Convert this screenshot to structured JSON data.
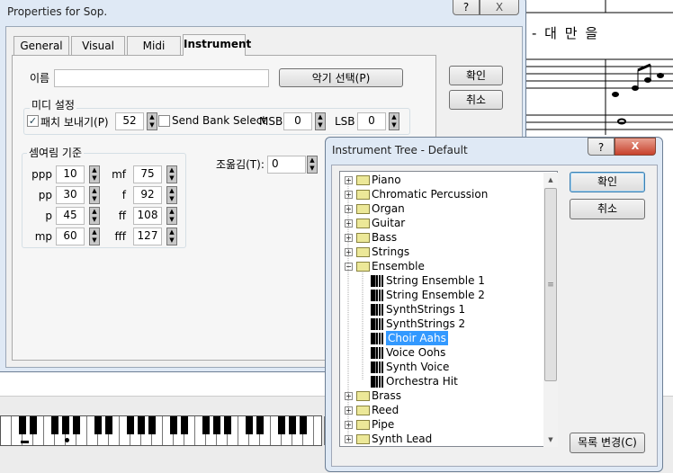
{
  "score": {
    "lyrics": "- 대 만   을"
  },
  "properties": {
    "title": "Properties for Sop.",
    "tabs": [
      {
        "label": "General"
      },
      {
        "label": "Visual"
      },
      {
        "label": "Midi"
      },
      {
        "label": "Instrument",
        "active": true
      }
    ],
    "ok": "확인",
    "cancel": "취소",
    "name_label": "이름",
    "name_value": "",
    "select_instrument": "악기 선택(P)",
    "midi_group": "미디 설정",
    "send_patch_label": "패치 보내기(P)",
    "send_patch_checked": true,
    "patch_value": "52",
    "send_bank_label": "Send Bank Select",
    "send_bank_checked": false,
    "msb_label": "MSB",
    "msb_value": "0",
    "lsb_label": "LSB",
    "lsb_value": "0",
    "dynamics_group": "셈여림 기준",
    "dynamics_left": [
      {
        "label": "ppp",
        "value": "10"
      },
      {
        "label": "pp",
        "value": "30"
      },
      {
        "label": "p",
        "value": "45"
      },
      {
        "label": "mp",
        "value": "60"
      }
    ],
    "dynamics_right": [
      {
        "label": "mf",
        "value": "75"
      },
      {
        "label": "f",
        "value": "92"
      },
      {
        "label": "ff",
        "value": "108"
      },
      {
        "label": "fff",
        "value": "127"
      }
    ],
    "transpose_label": "조옮김(T):",
    "transpose_value": "0",
    "help": "?",
    "close": "X"
  },
  "tree_dialog": {
    "title": "Instrument Tree - Default",
    "help": "?",
    "close": "X",
    "ok": "확인",
    "cancel": "취소",
    "change_list": "목록 변경(C)",
    "items": [
      {
        "label": "Piano",
        "type": "folder"
      },
      {
        "label": "Chromatic Percussion",
        "type": "folder"
      },
      {
        "label": "Organ",
        "type": "folder"
      },
      {
        "label": "Guitar",
        "type": "folder"
      },
      {
        "label": "Bass",
        "type": "folder"
      },
      {
        "label": "Strings",
        "type": "folder"
      },
      {
        "label": "Ensemble",
        "type": "folder",
        "expanded": true
      },
      {
        "label": "String Ensemble 1",
        "type": "instrument"
      },
      {
        "label": "String Ensemble 2",
        "type": "instrument"
      },
      {
        "label": "SynthStrings 1",
        "type": "instrument"
      },
      {
        "label": "SynthStrings 2",
        "type": "instrument"
      },
      {
        "label": "Choir Aahs",
        "type": "instrument",
        "selected": true
      },
      {
        "label": "Voice Oohs",
        "type": "instrument"
      },
      {
        "label": "Synth Voice",
        "type": "instrument"
      },
      {
        "label": "Orchestra Hit",
        "type": "instrument"
      },
      {
        "label": "Brass",
        "type": "folder"
      },
      {
        "label": "Reed",
        "type": "folder"
      },
      {
        "label": "Pipe",
        "type": "folder"
      },
      {
        "label": "Synth Lead",
        "type": "folder"
      }
    ]
  }
}
